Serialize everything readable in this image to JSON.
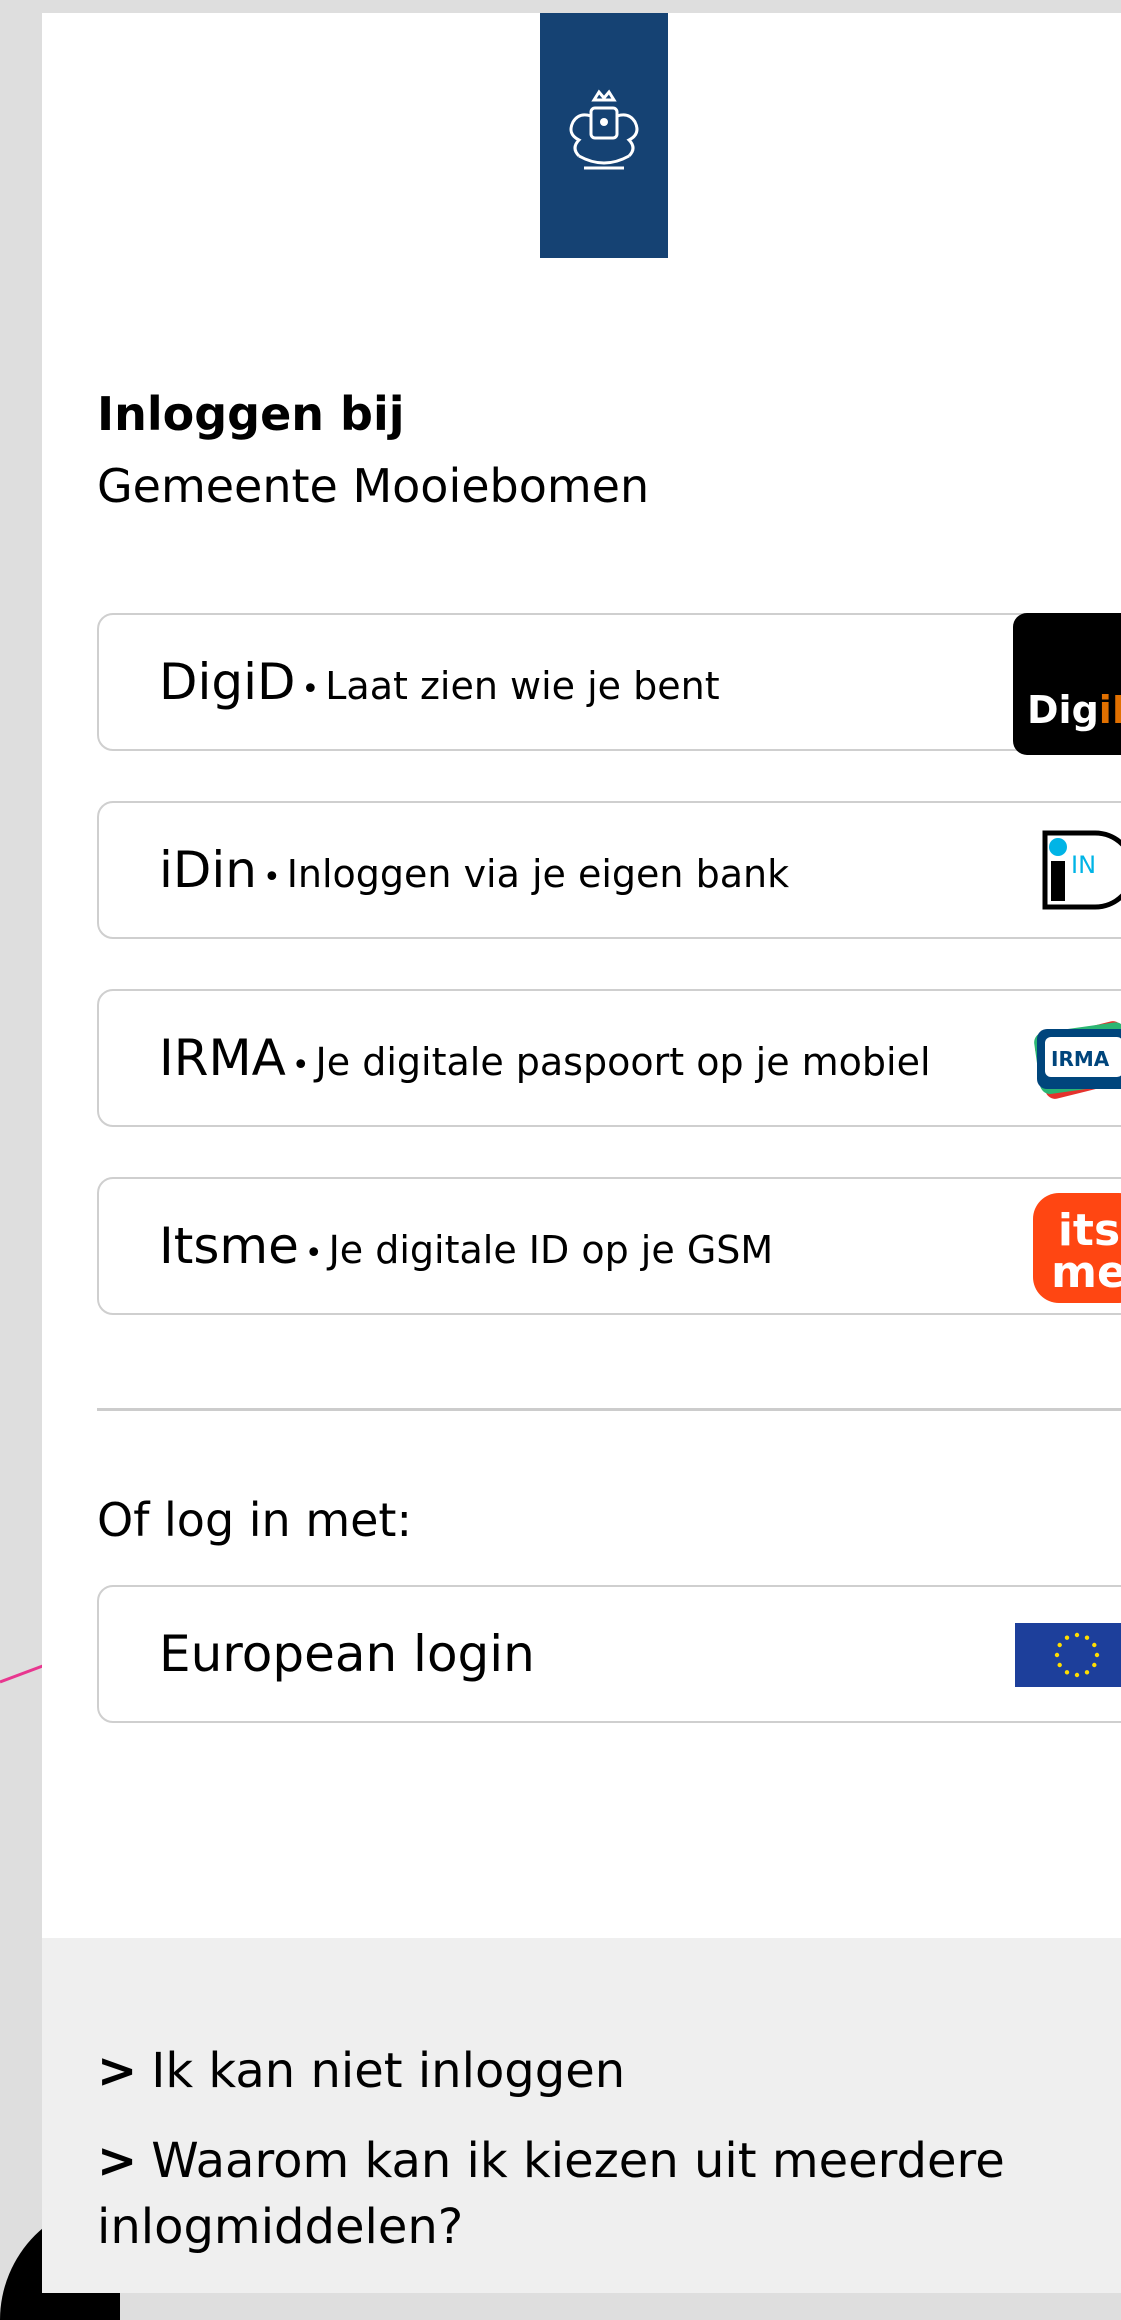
{
  "header": {
    "logo": "rijksoverheid-coat-of-arms-icon",
    "brand_color": "#154273"
  },
  "title": {
    "line1": "Inloggen bij",
    "line2": "Gemeente Mooiebomen"
  },
  "options": [
    {
      "name": "DigiD",
      "desc": "Laat zien wie je bent",
      "icon": "digid-logo-icon"
    },
    {
      "name": "iDin",
      "desc": "Inloggen via je eigen bank",
      "icon": "idin-logo-icon"
    },
    {
      "name": "IRMA",
      "desc": "Je digitale paspoort op je mobiel",
      "icon": "irma-logo-icon"
    },
    {
      "name": "Itsme",
      "desc": "Je digitale ID op je GSM",
      "icon": "itsme-logo-icon"
    }
  ],
  "separator": "•",
  "or_label": "Of log in met:",
  "european": {
    "label": "European login",
    "icon": "eu-flag-icon"
  },
  "logo_text": {
    "digid_a": "Dig",
    "digid_b": "iD",
    "idin": "IN",
    "irma": "IRMA",
    "itsme_a": "its",
    "itsme_b": "me"
  },
  "footer": {
    "chevron": ">",
    "links": [
      "Ik kan niet inloggen",
      "Waarom kan ik kiezen uit meerdere inlogmiddelen?"
    ]
  },
  "colors": {
    "digid_orange": "#e17000",
    "itsme_orange": "#ff4612",
    "eu_blue": "#1d3f9b",
    "annotation_pink": "#e8368f"
  }
}
